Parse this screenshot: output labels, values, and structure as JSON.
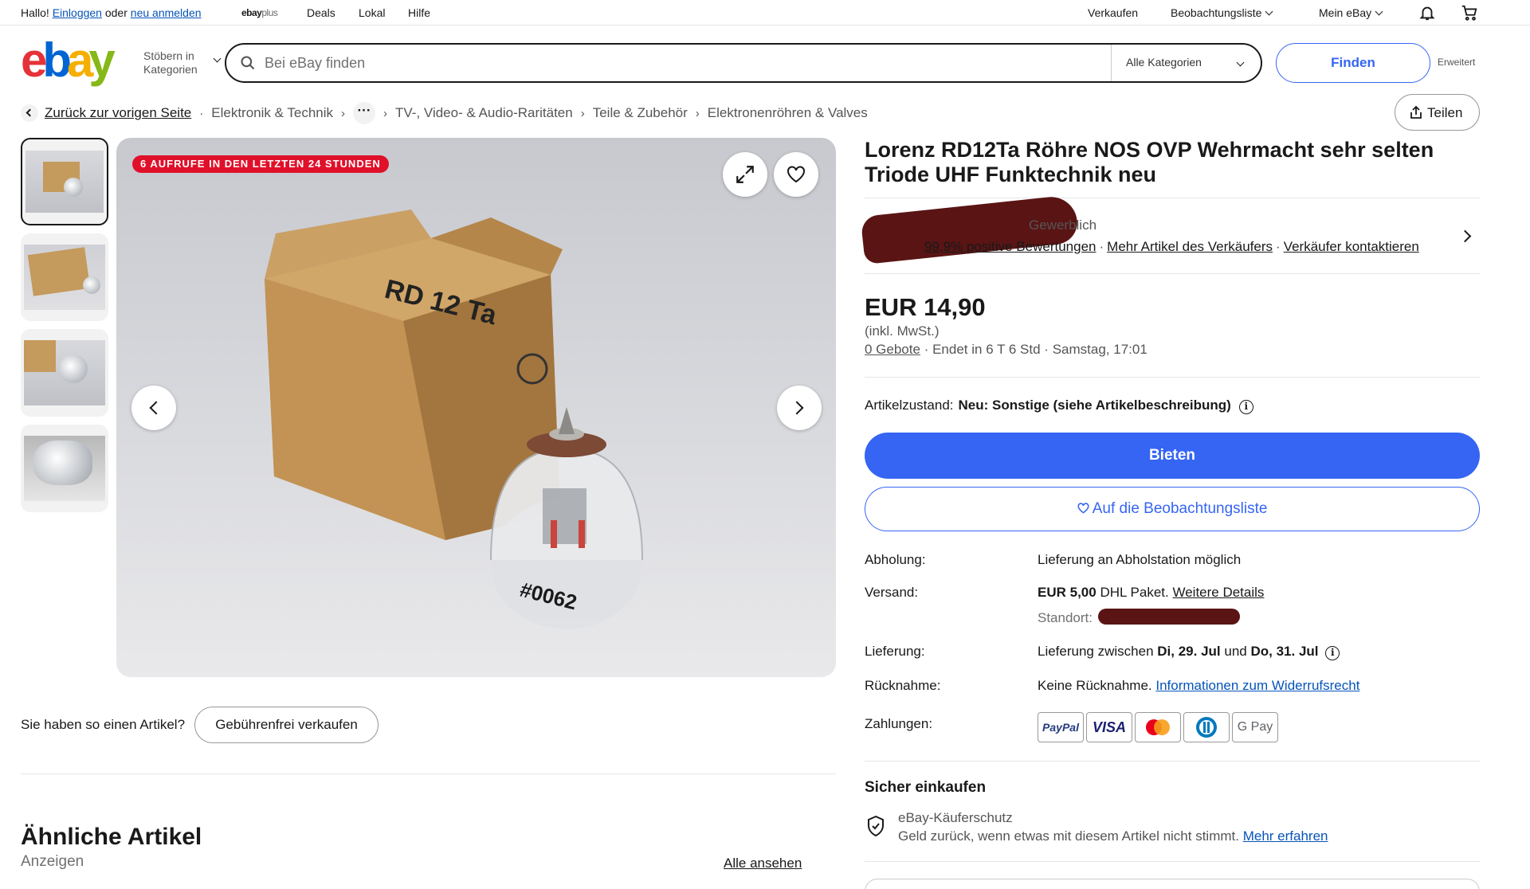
{
  "topbar": {
    "greeting": "Hallo!",
    "login": "Einloggen",
    "or": "oder",
    "register": "neu anmelden",
    "ebayplus_brand": "ebay",
    "ebayplus_plus": "plus",
    "deals": "Deals",
    "lokal": "Lokal",
    "hilfe": "Hilfe",
    "verkaufen": "Verkaufen",
    "watchlist": "Beobachtungsliste",
    "my_ebay": "Mein eBay"
  },
  "header": {
    "logo": [
      "e",
      "b",
      "a",
      "y"
    ],
    "browse_line1": "Stöbern in",
    "browse_line2": "Kategorien",
    "search_placeholder": "Bei eBay finden",
    "category_select": "Alle Kategorien",
    "search_button": "Finden",
    "advanced": "Erweitert"
  },
  "breadcrumb": {
    "back": "Zurück zur vorigen Seite",
    "items": [
      "Elektronik & Technik",
      "TV-, Video- & Audio-Raritäten",
      "Teile & Zubehör",
      "Elektronenröhren & Valves"
    ],
    "share": "Teilen"
  },
  "gallery": {
    "views_badge": "6 AUFRUFE IN DEN LETZTEN 24 STUNDEN",
    "box_label": "RD 12 Ta",
    "tube_label": "#0062"
  },
  "sell_prompt": {
    "question": "Sie haben so einen Artikel?",
    "button": "Gebührenfrei verkaufen"
  },
  "similar": {
    "title": "Ähnliche Artikel",
    "subtitle": "Anzeigen",
    "see_all": "Alle ansehen"
  },
  "item": {
    "title": "Lorenz RD12Ta Röhre NOS OVP Wehrmacht sehr selten Triode UHF Funktechnik neu",
    "seller_type": "Gewerblich",
    "seller_feedback": "99,9% positive Bewertungen",
    "seller_more": "Mehr Artikel des Verkäufers",
    "seller_contact": "Verkäufer kontaktieren",
    "price": "EUR 14,90",
    "vat": "(inkl. MwSt.)",
    "bids": "0 Gebote",
    "ends": "Endet in 6 T 6 Std",
    "end_time": "Samstag, 17:01",
    "condition_label": "Artikelzustand:",
    "condition_value": "Neu: Sonstige (siehe Artikelbeschreibung)",
    "bid_button": "Bieten",
    "watch_button": "Auf die Beobachtungsliste"
  },
  "details": {
    "pickup_label": "Abholung:",
    "pickup_value": "Lieferung an Abholstation möglich",
    "shipping_label": "Versand:",
    "shipping_price": "EUR 5,00",
    "shipping_service": "DHL Paket.",
    "shipping_details": "Weitere Details",
    "location_label": "Standort:",
    "delivery_label": "Lieferung:",
    "delivery_prefix": "Lieferung zwischen",
    "delivery_from": "Di, 29. Jul",
    "delivery_and": "und",
    "delivery_to": "Do, 31. Jul",
    "returns_label": "Rücknahme:",
    "returns_value": "Keine Rücknahme.",
    "returns_link": "Informationen zum Widerrufsrecht",
    "payments_label": "Zahlungen:",
    "payments": [
      "PayPal",
      "VISA",
      "Mastercard",
      "Diners Club",
      "G Pay"
    ]
  },
  "safe": {
    "title": "Sicher einkaufen",
    "protection": "eBay-Käuferschutz",
    "protection_text": "Geld zurück, wenn etwas mit diesem Artikel nicht stimmt.",
    "learn_more": "Mehr erfahren"
  },
  "colors": {
    "brand_blue": "#3665f3",
    "link_blue": "#0654ba",
    "badge_red": "#e0102a",
    "redaction": "#5a1414"
  }
}
